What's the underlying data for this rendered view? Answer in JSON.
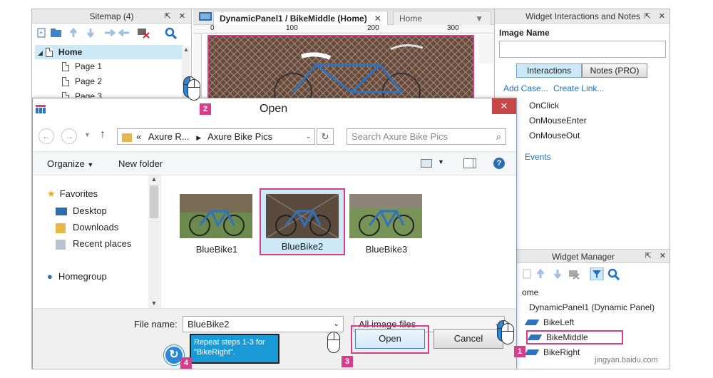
{
  "sitemap": {
    "title": "Sitemap (4)",
    "home": "Home",
    "pages": [
      "Page 1",
      "Page 2",
      "Page 3"
    ]
  },
  "canvas": {
    "tab_active": "DynamicPanel1 / BikeMiddle (Home)",
    "tab_inactive": "Home",
    "ruler_ticks": [
      "0",
      "100",
      "200",
      "300"
    ]
  },
  "interactions": {
    "title": "Widget Interactions and Notes",
    "image_name_label": "Image Name",
    "tab_interactions": "Interactions",
    "tab_notes": "Notes (PRO)",
    "add_case": "Add Case...",
    "create_link": "Create Link...",
    "events": [
      "OnClick",
      "OnMouseEnter",
      "OnMouseOut"
    ],
    "more_events": "Events"
  },
  "widget_manager": {
    "title": "Widget Manager",
    "root": "ome",
    "panel": "DynamicPanel1 (Dynamic Panel)",
    "states": [
      "BikeLeft",
      "BikeMiddle",
      "BikeRight"
    ]
  },
  "dialog": {
    "title": "Open",
    "breadcrumb": [
      "Axure R...",
      "Axure Bike Pics"
    ],
    "breadcrumb_prefix": "«",
    "search_placeholder": "Search Axure Bike Pics",
    "organize": "Organize",
    "new_folder": "New folder",
    "nav": {
      "favorites": "Favorites",
      "items": [
        "Desktop",
        "Downloads",
        "Recent places"
      ],
      "homegroup": "Homegroup"
    },
    "files": [
      "BlueBike1",
      "BlueBike2",
      "BlueBike3"
    ],
    "selected_file": "BlueBike2",
    "file_name_label": "File name:",
    "file_name_value": "BlueBike2",
    "file_type": "All image files",
    "open_button": "Open",
    "cancel_button": "Cancel",
    "close_glyph": "✕"
  },
  "callouts": {
    "n1": "1",
    "n2": "2",
    "n3": "3",
    "n4": "4",
    "tooltip": "Repeat steps 1-3 for \"BikeRight\"."
  },
  "watermark": "jingyan.baidu.com",
  "colors": {
    "accent_pink": "#d63e8c",
    "selection_blue": "#cde8f7",
    "tooltip_blue": "#1a9ad6",
    "link_blue": "#1a6fc4",
    "dialog_close_red": "#c74647"
  }
}
